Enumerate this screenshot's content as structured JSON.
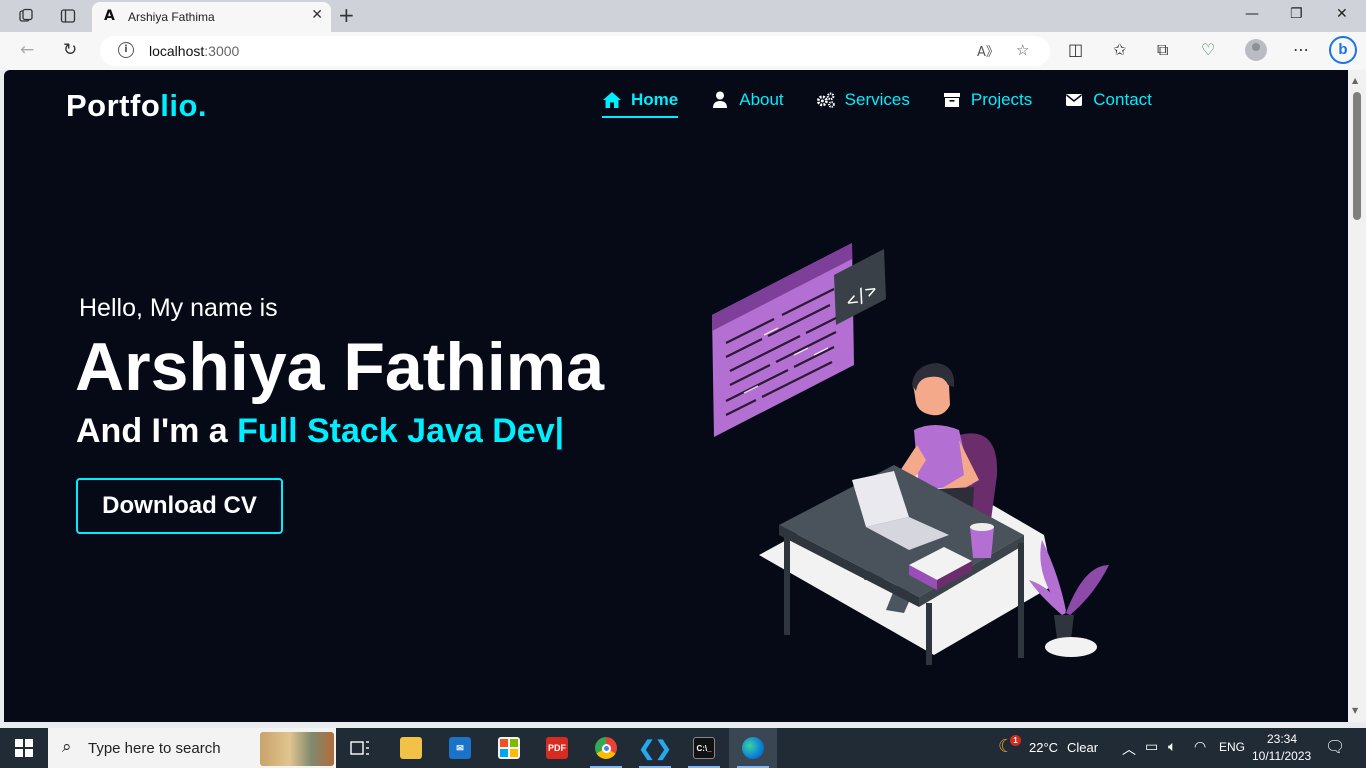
{
  "browser": {
    "tab_title": "Arshiya Fathima",
    "tab_favicon": "A",
    "url_host": "localhost",
    "url_port": ":3000"
  },
  "site": {
    "logo_main": "Portfo",
    "logo_accent": "lio.",
    "nav": [
      {
        "label": "Home",
        "icon": "home-icon",
        "active": true
      },
      {
        "label": "About",
        "icon": "user-icon",
        "active": false
      },
      {
        "label": "Services",
        "icon": "gears-icon",
        "active": false
      },
      {
        "label": "Projects",
        "icon": "archive-icon",
        "active": false
      },
      {
        "label": "Contact",
        "icon": "envelope-icon",
        "active": false
      }
    ],
    "hero": {
      "greeting": "Hello, My name is",
      "name": "Arshiya Fathima",
      "role_prefix": "And I'm a ",
      "role_typed": "Full Stack Java Dev|",
      "cta": "Download CV"
    },
    "colors": {
      "accent": "#00eeff",
      "background": "#050a16",
      "illustration_purple": "#b36fd1"
    }
  },
  "taskbar": {
    "search_placeholder": "Type here to search",
    "weather_temp": "22°C",
    "weather_desc": "Clear",
    "weather_badge": "1",
    "language": "ENG",
    "time": "23:34",
    "date": "10/11/2023",
    "pdf_label": "PDF"
  }
}
